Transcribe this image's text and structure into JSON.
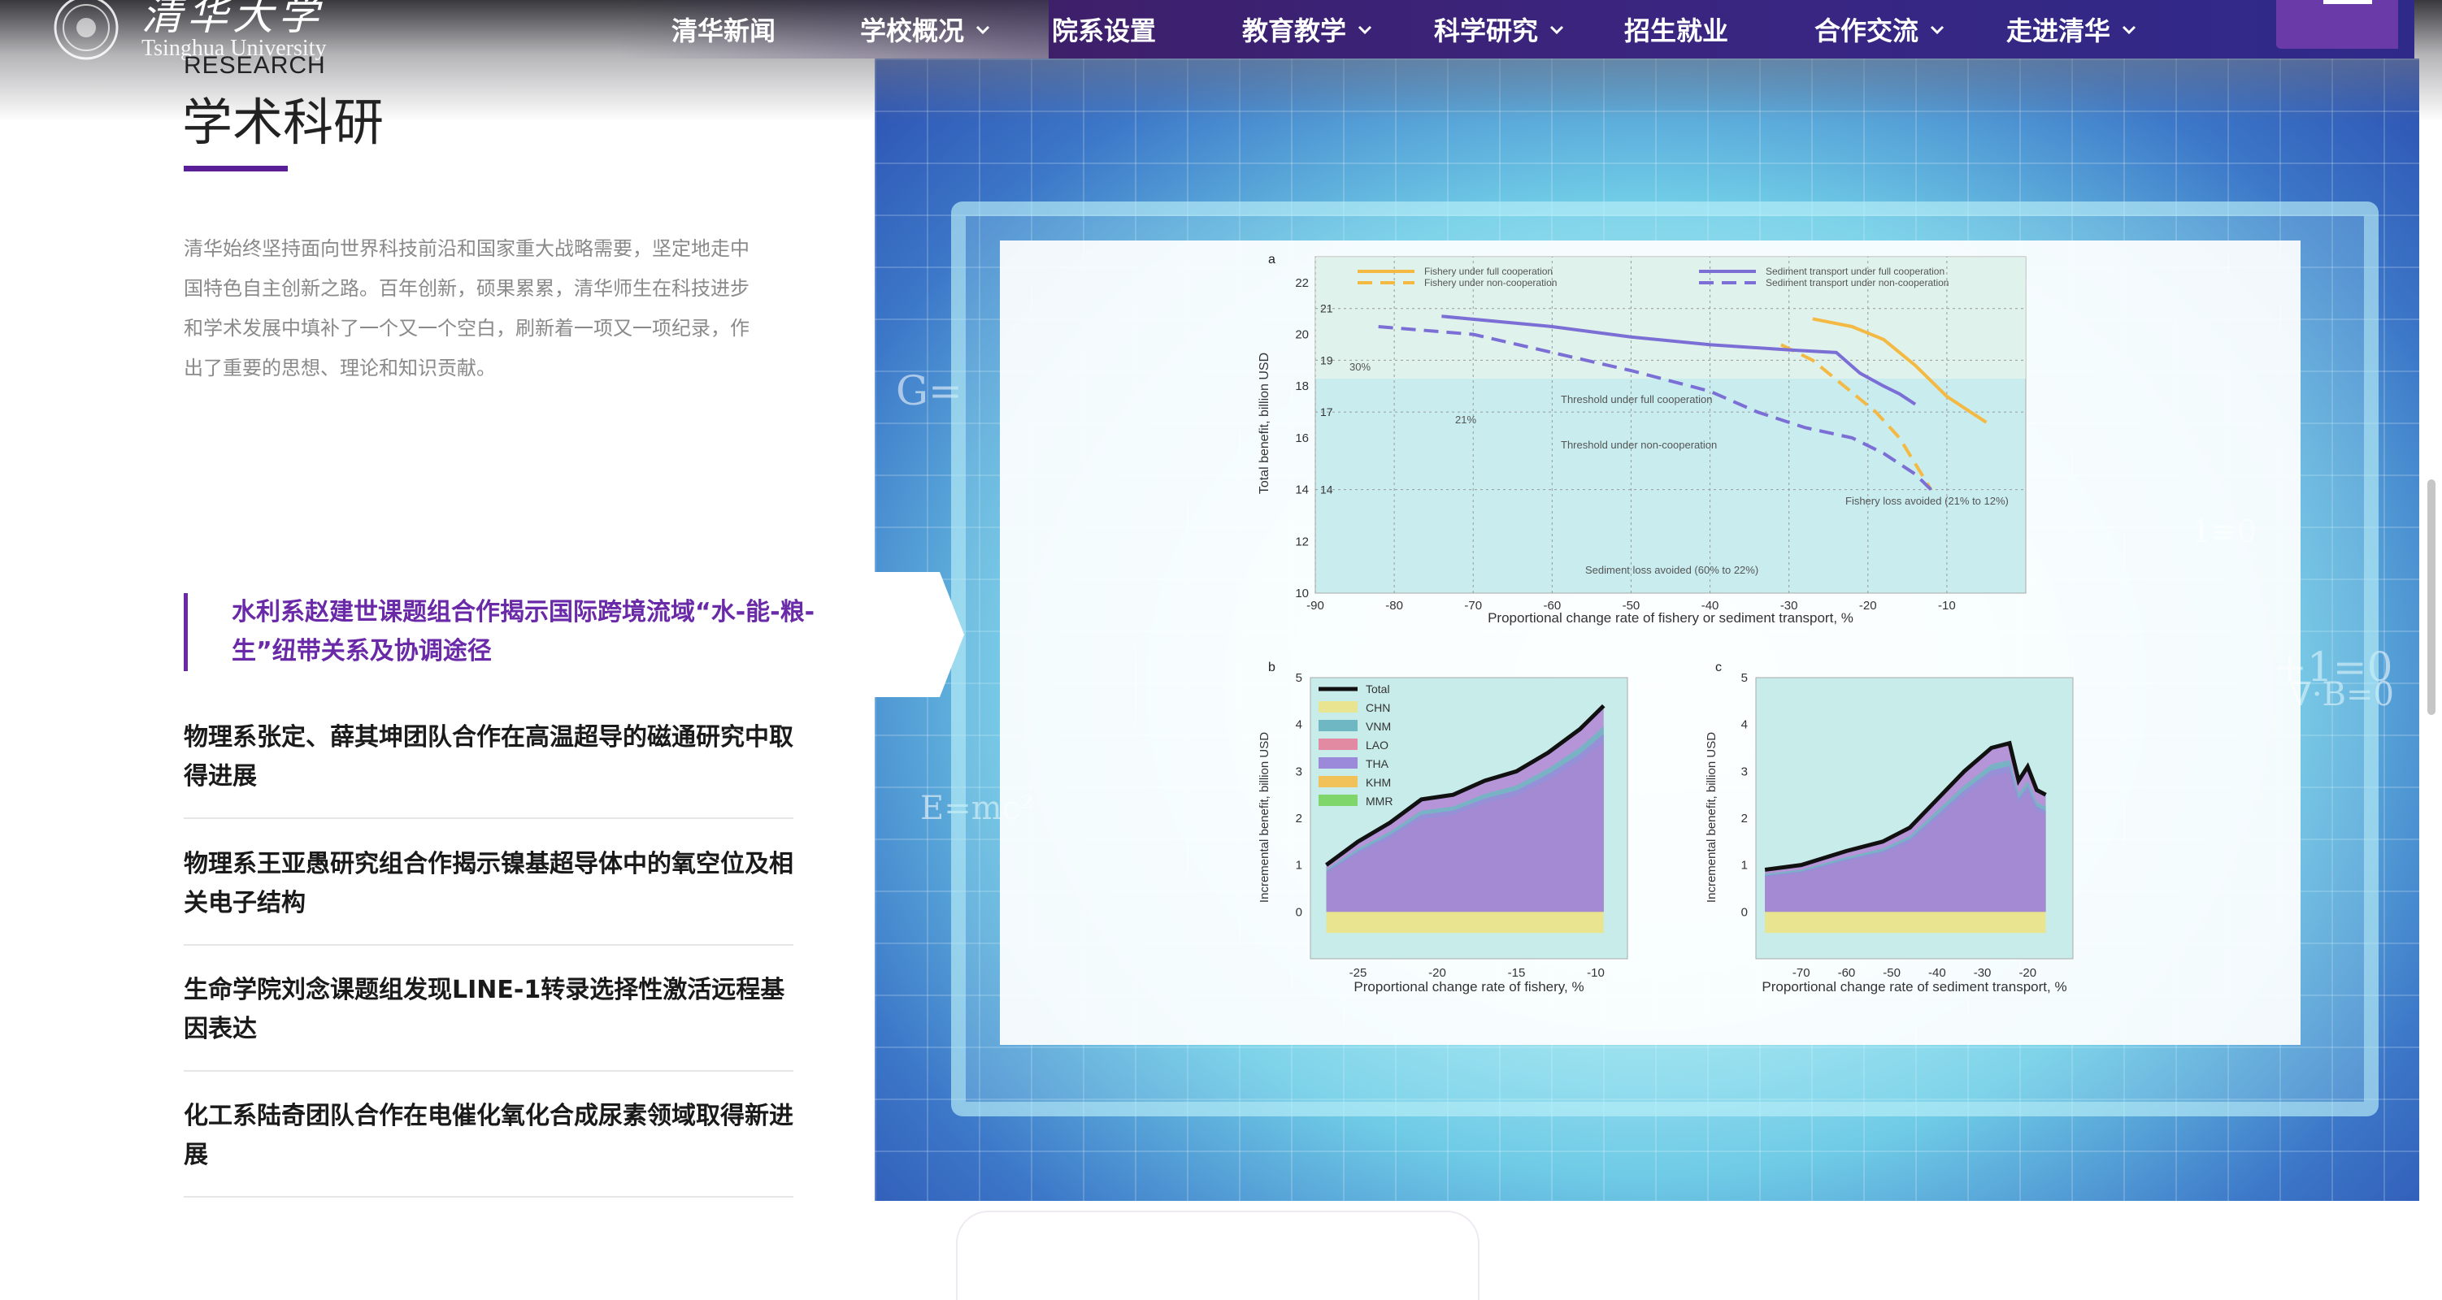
{
  "header": {
    "logo_cn": "清华大学",
    "logo_en": "Tsinghua University",
    "nav": [
      {
        "label": "清华新闻",
        "has_dropdown": false
      },
      {
        "label": "学校概况",
        "has_dropdown": true
      },
      {
        "label": "院系设置",
        "has_dropdown": false
      },
      {
        "label": "教育教学",
        "has_dropdown": true
      },
      {
        "label": "科学研究",
        "has_dropdown": true
      },
      {
        "label": "招生就业",
        "has_dropdown": false
      },
      {
        "label": "合作交流",
        "has_dropdown": true
      },
      {
        "label": "走进清华",
        "has_dropdown": true
      }
    ],
    "menu_icon": "hamburger-icon"
  },
  "section": {
    "label_en": "RESEARCH",
    "title": "学术科研",
    "intro": "清华始终坚持面向世界科技前沿和国家重大战略需要，坚定地走中国特色自主创新之路。百年创新，硕果累累，清华师生在科技进步和学术发展中填补了一个又一个空白，刷新着一项又一项纪录，作出了重要的思想、理论和知识贡献。"
  },
  "news": {
    "active": "水利系赵建世课题组合作揭示国际跨境流域“水-能-粮-生”纽带关系及协调途径",
    "items": [
      "物理系张定、薛其坤团队合作在高温超导的磁通研究中取得进展",
      "物理系王亚愚研究组合作揭示镍基超导体中的氧空位及相关电子结构",
      "生命学院刘念课题组发现LINE-1转录选择性激活远程基因表达",
      "化工系陆奇团队合作在电催化氧化合成尿素领域取得新进展"
    ]
  },
  "colors": {
    "accent": "#5a1e96",
    "active_text": "#6a2aa8",
    "nav_bg": "#3a2580",
    "fishery": "#f4b942",
    "sediment": "#7b6fd6"
  },
  "chart_data": [
    {
      "type": "line",
      "panel": "a",
      "xlabel": "Proportional change rate of fishery or sediment transport, %",
      "ylabel": "Total benefit, billion USD",
      "xlim": [
        -90,
        0
      ],
      "ylim": [
        10,
        23
      ],
      "xticks": [
        -90,
        -80,
        -70,
        -60,
        -50,
        -40,
        -30,
        -20,
        -10
      ],
      "yticks": [
        10,
        12,
        14,
        16,
        18,
        20,
        22
      ],
      "ytick_labels_extra": [
        "21",
        "19",
        "17",
        "14"
      ],
      "series": [
        {
          "name": "Fishery under full cooperation",
          "style": "solid",
          "color": "#f4b942",
          "x": [
            -27,
            -22,
            -18,
            -14,
            -10,
            -5
          ],
          "y": [
            20.6,
            20.3,
            19.8,
            18.8,
            17.6,
            16.6
          ]
        },
        {
          "name": "Fishery under non-cooperation",
          "style": "dashed",
          "color": "#f4b942",
          "x": [
            -31,
            -27,
            -23,
            -19,
            -16,
            -14,
            -12
          ],
          "y": [
            19.6,
            19.0,
            18.0,
            17.0,
            16.0,
            15.0,
            14.0
          ]
        },
        {
          "name": "Sediment transport under full cooperation",
          "style": "solid",
          "color": "#7b6fd6",
          "x": [
            -74,
            -60,
            -50,
            -40,
            -30,
            -24,
            -21,
            -18,
            -16,
            -14
          ],
          "y": [
            20.7,
            20.3,
            19.9,
            19.6,
            19.4,
            19.3,
            18.5,
            18.0,
            17.7,
            17.3
          ]
        },
        {
          "name": "Sediment transport under non-cooperation",
          "style": "dashed",
          "color": "#7b6fd6",
          "x": [
            -82,
            -70,
            -60,
            -50,
            -40,
            -34,
            -28,
            -22,
            -18,
            -14,
            -12
          ],
          "y": [
            20.3,
            20.0,
            19.3,
            18.6,
            17.8,
            17.0,
            16.4,
            16.0,
            15.4,
            14.6,
            14.0
          ]
        }
      ],
      "annotations": [
        "30%",
        "21%",
        "Threshold under full cooperation",
        "Threshold under non-cooperation",
        "Fishery loss avoided (21% to 12%)",
        "Sediment loss avoided (60% to 22%)"
      ]
    },
    {
      "type": "area",
      "panel": "b",
      "xlabel": "Proportional change rate of fishery, %",
      "ylabel": "Incremental benefit, billion USD",
      "xlim": [
        -28,
        -8
      ],
      "ylim": [
        -1,
        5
      ],
      "xticks": [
        -25,
        -20,
        -15,
        -10
      ],
      "yticks": [
        0,
        1,
        2,
        3,
        4,
        5
      ],
      "legend": [
        "Total",
        "CHN",
        "VNM",
        "LAO",
        "THA",
        "KHM",
        "MMR"
      ],
      "total": {
        "x": [
          -27,
          -25,
          -23,
          -21,
          -19,
          -17,
          -15,
          -13,
          -11,
          -9.5
        ],
        "y": [
          1.0,
          1.5,
          1.9,
          2.4,
          2.5,
          2.8,
          3.0,
          3.4,
          3.9,
          4.4
        ]
      }
    },
    {
      "type": "area",
      "panel": "c",
      "xlabel": "Proportional change rate of sediment transport, %",
      "ylabel": "Incremental benefit, billion USD",
      "xlim": [
        -80,
        -10
      ],
      "ylim": [
        -1,
        5
      ],
      "xticks": [
        -70,
        -60,
        -50,
        -40,
        -30,
        -20
      ],
      "yticks": [
        0,
        1,
        2,
        3,
        4,
        5
      ],
      "total": {
        "x": [
          -78,
          -70,
          -60,
          -52,
          -46,
          -40,
          -34,
          -28,
          -24,
          -22,
          -20,
          -18,
          -16
        ],
        "y": [
          0.9,
          1.0,
          1.3,
          1.5,
          1.8,
          2.4,
          3.0,
          3.5,
          3.6,
          2.8,
          3.1,
          2.6,
          2.5
        ]
      }
    }
  ]
}
